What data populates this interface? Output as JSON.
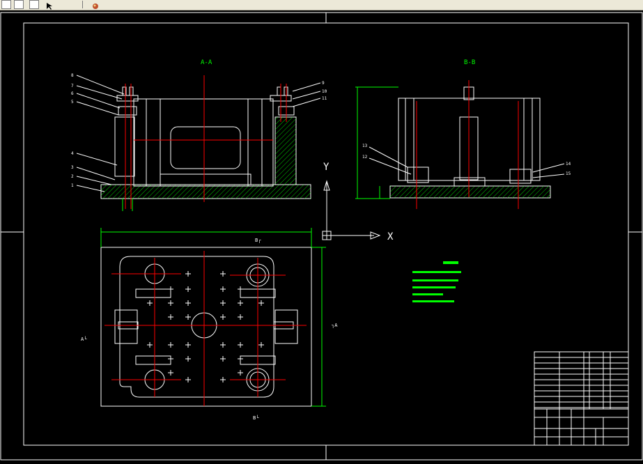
{
  "toolbar": {
    "icons": [
      "page-icon",
      "page-icon",
      "grid-icon",
      "pointer-icon",
      "pan-icon"
    ]
  },
  "drawing": {
    "section_aa_label": "A-A",
    "section_bb_label": "B-B",
    "plan_top_label": "B┌",
    "plan_left_label": "A└",
    "plan_right_label": "┐A",
    "plan_bottom_label": "B└",
    "ucs_x_label": "X",
    "ucs_y_label": "Y",
    "part_numbers_left": [
      "8",
      "7",
      "6",
      "5",
      "4",
      "3",
      "2",
      "1"
    ],
    "part_numbers_right": [
      "9",
      "10",
      "11"
    ],
    "part_numbers_bb_left": [
      "13",
      "12"
    ],
    "part_numbers_bb_right": [
      "14",
      "15"
    ],
    "colors": {
      "outline": "#ffffff",
      "center": "#ff0000",
      "dimension": "#00ff00",
      "hatch": "#00ff00",
      "section_label": "#00ff00",
      "frame": "#ffffff"
    }
  }
}
